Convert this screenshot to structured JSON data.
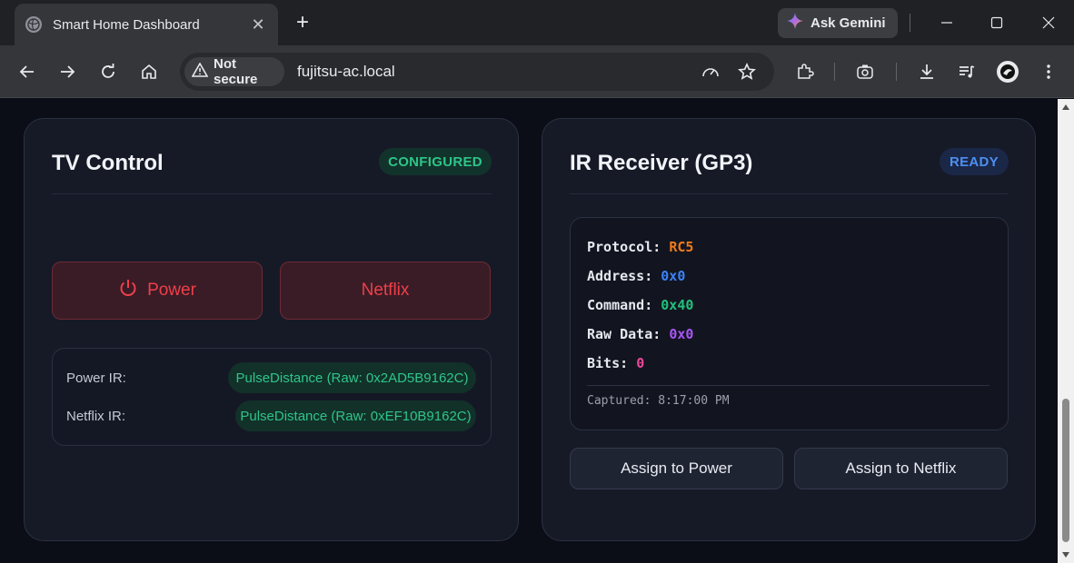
{
  "browser": {
    "tab_title": "Smart Home Dashboard",
    "gemini_label": "Ask Gemini",
    "security_label": "Not secure",
    "url": "fujitsu-ac.local"
  },
  "tv": {
    "title": "TV Control",
    "status": "CONFIGURED",
    "power_label": "Power",
    "netflix_label": "Netflix",
    "ir_codes": [
      {
        "label": "Power IR:",
        "value": "PulseDistance (Raw: 0x2AD5B9162C)"
      },
      {
        "label": "Netflix IR:",
        "value": "PulseDistance (Raw: 0xEF10B9162C)"
      }
    ]
  },
  "receiver": {
    "title": "IR Receiver (GP3)",
    "status": "READY",
    "fields": [
      {
        "label": "Protocol:",
        "value": "RC5",
        "color": "#f07a1a"
      },
      {
        "label": "Address:",
        "value": "0x0",
        "color": "#3b82f6"
      },
      {
        "label": "Command:",
        "value": "0x40",
        "color": "#22c07a"
      },
      {
        "label": "Raw Data:",
        "value": "0x0",
        "color": "#a855f7"
      },
      {
        "label": "Bits:",
        "value": "0",
        "color": "#ec4899"
      }
    ],
    "captured": "Captured: 8:17:00 PM",
    "assign_power": "Assign to Power",
    "assign_netflix": "Assign to Netflix"
  },
  "colors": {
    "configured_bg": "#12332b",
    "configured_fg": "#2ec58a",
    "ready_bg": "#1b2747",
    "ready_fg": "#4d8ff0"
  }
}
